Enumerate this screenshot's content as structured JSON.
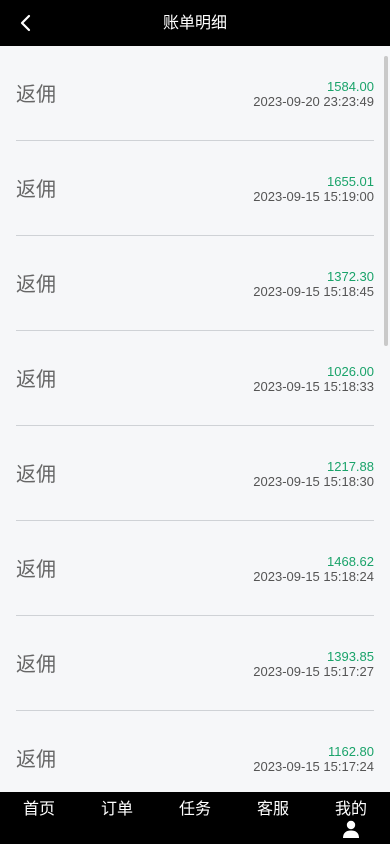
{
  "header": {
    "title": "账单明细",
    "back_icon": "chevron-left-icon"
  },
  "records": [
    {
      "label": "返佣",
      "amount": "1584.00",
      "time": "2023-09-20 23:23:49"
    },
    {
      "label": "返佣",
      "amount": "1655.01",
      "time": "2023-09-15 15:19:00"
    },
    {
      "label": "返佣",
      "amount": "1372.30",
      "time": "2023-09-15 15:18:45"
    },
    {
      "label": "返佣",
      "amount": "1026.00",
      "time": "2023-09-15 15:18:33"
    },
    {
      "label": "返佣",
      "amount": "1217.88",
      "time": "2023-09-15 15:18:30"
    },
    {
      "label": "返佣",
      "amount": "1468.62",
      "time": "2023-09-15 15:18:24"
    },
    {
      "label": "返佣",
      "amount": "1393.85",
      "time": "2023-09-15 15:17:27"
    },
    {
      "label": "返佣",
      "amount": "1162.80",
      "time": "2023-09-15 15:17:24"
    }
  ],
  "tabbar": {
    "items": [
      {
        "label": "首页"
      },
      {
        "label": "订单"
      },
      {
        "label": "任务"
      },
      {
        "label": "客服"
      },
      {
        "label": "我的",
        "icon": "user-icon"
      }
    ]
  },
  "colors": {
    "header_bg": "#000000",
    "amount": "#1aa36a",
    "label": "#666666",
    "time": "#555555",
    "page_bg": "#f6f7f9"
  }
}
